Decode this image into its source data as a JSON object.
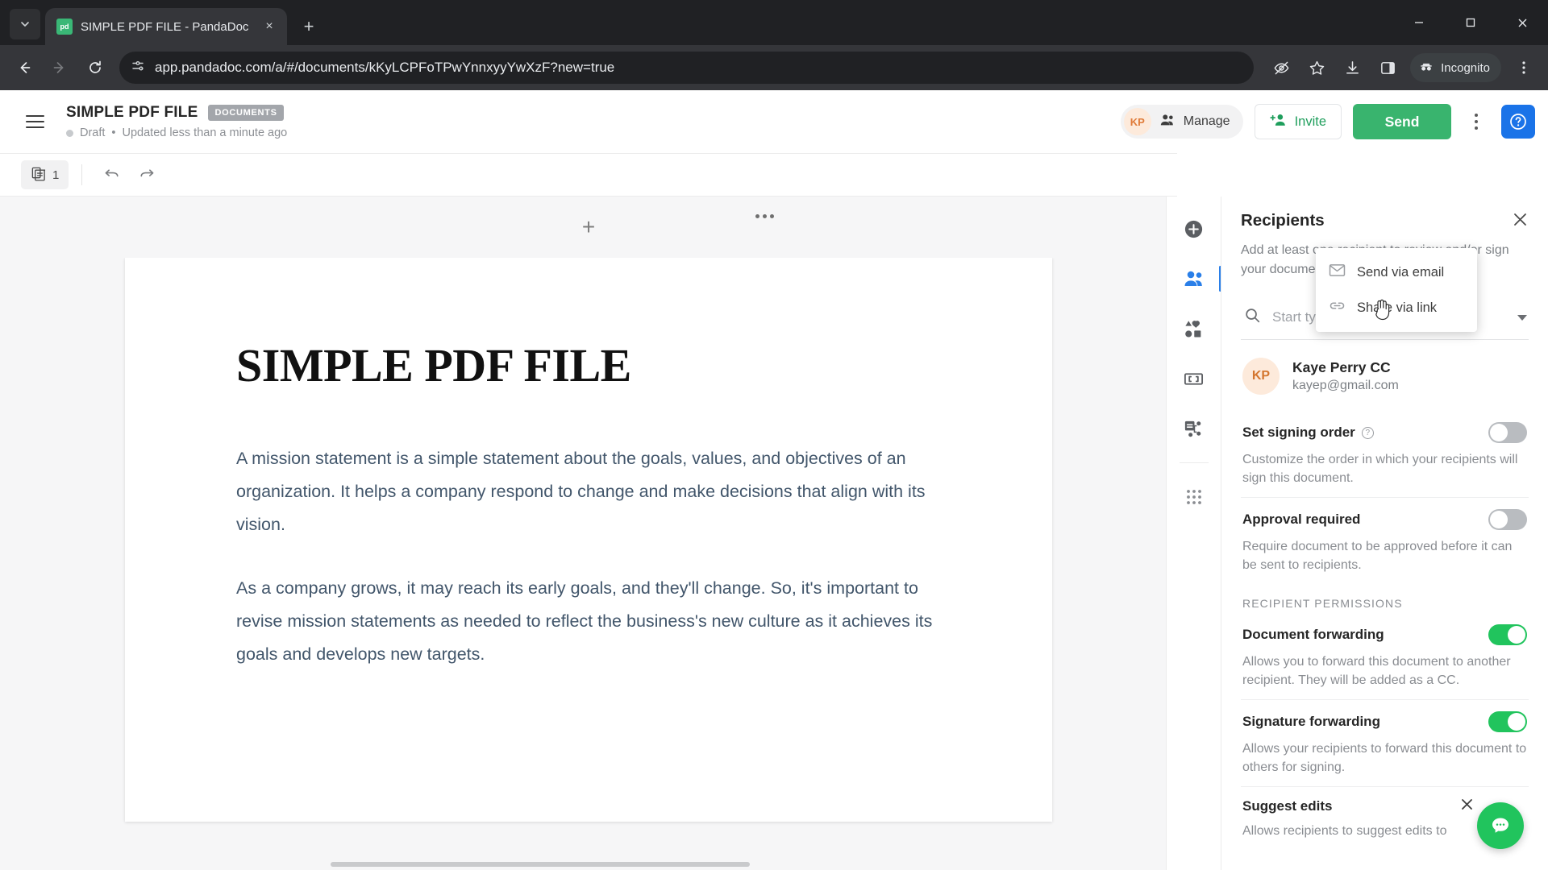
{
  "browser": {
    "tab": {
      "title": "SIMPLE PDF FILE - PandaDoc",
      "favicon_text": "pd"
    },
    "new_tab_label": "+",
    "close_label": "×",
    "url": "app.pandadoc.com/a/#/documents/kKyLCPFoTPwYnnxyyYwXzF?new=true",
    "incognito_label": "Incognito",
    "window": {
      "minimize": "─",
      "maximize": "❐",
      "close": "✕"
    }
  },
  "app_header": {
    "doc_title": "SIMPLE PDF FILE",
    "badge": "DOCUMENTS",
    "status": "Draft",
    "status_sep": "•",
    "updated": "Updated less than a minute ago",
    "manage_avatar": "KP",
    "manage_label": "Manage",
    "invite_label": "Invite",
    "send_label": "Send",
    "help_label": "?"
  },
  "send_menu": {
    "items": [
      {
        "label": "Send via email",
        "icon": "envelope-icon"
      },
      {
        "label": "Share via link",
        "icon": "link-icon"
      }
    ]
  },
  "doc_toolbar": {
    "page_count": "1"
  },
  "canvas": {
    "add_label": "+"
  },
  "document": {
    "title": "SIMPLE PDF FILE",
    "paragraphs": [
      "A mission statement is a simple statement about the goals, values, and objectives of an organization. It helps a company respond to change and make decisions that align with its vision.",
      "As a company grows, it may reach its early goals, and they'll change. So, it's important to revise mission statements as needed to reflect the business's new culture as it achieves its goals and develops new targets."
    ]
  },
  "rail": {
    "items": [
      {
        "name": "add-content-icon",
        "active": false
      },
      {
        "name": "recipients-icon",
        "active": true
      },
      {
        "name": "content-library-icon",
        "active": false
      },
      {
        "name": "variables-icon",
        "active": false
      },
      {
        "name": "workflow-icon",
        "active": false
      },
      {
        "name": "apps-grid-icon",
        "active": false
      }
    ]
  },
  "panel": {
    "title": "Recipients",
    "close_label": "✕",
    "subtitle": "Add at least one recipient to review and/or sign your document.",
    "search_placeholder": "Start typing name or email",
    "recipient": {
      "initials": "KP",
      "name": "Kaye Perry",
      "role": "CC",
      "email": "kayep@gmail.com"
    },
    "settings": [
      {
        "label": "Set signing order",
        "desc": "Customize the order in which your recipients will sign this document.",
        "on": false,
        "has_info": true
      },
      {
        "label": "Approval required",
        "desc": "Require document to be approved before it can be sent to recipients.",
        "on": false,
        "has_info": false
      }
    ],
    "permissions_caption": "RECIPIENT PERMISSIONS",
    "permissions": [
      {
        "label": "Document forwarding",
        "desc": "Allows you to forward this document to another recipient. They will be added as a CC.",
        "on": true
      },
      {
        "label": "Signature forwarding",
        "desc": "Allows your recipients to forward this document to others for signing.",
        "on": true
      },
      {
        "label": "Suggest edits",
        "desc": "Allows recipients to suggest edits to",
        "on": true
      }
    ]
  },
  "colors": {
    "send_green": "#39b46e",
    "toggle_green": "#21c45d",
    "accent_blue": "#2a7fe8",
    "help_blue": "#1a73e8",
    "badge_gray": "#a3a6ab"
  }
}
